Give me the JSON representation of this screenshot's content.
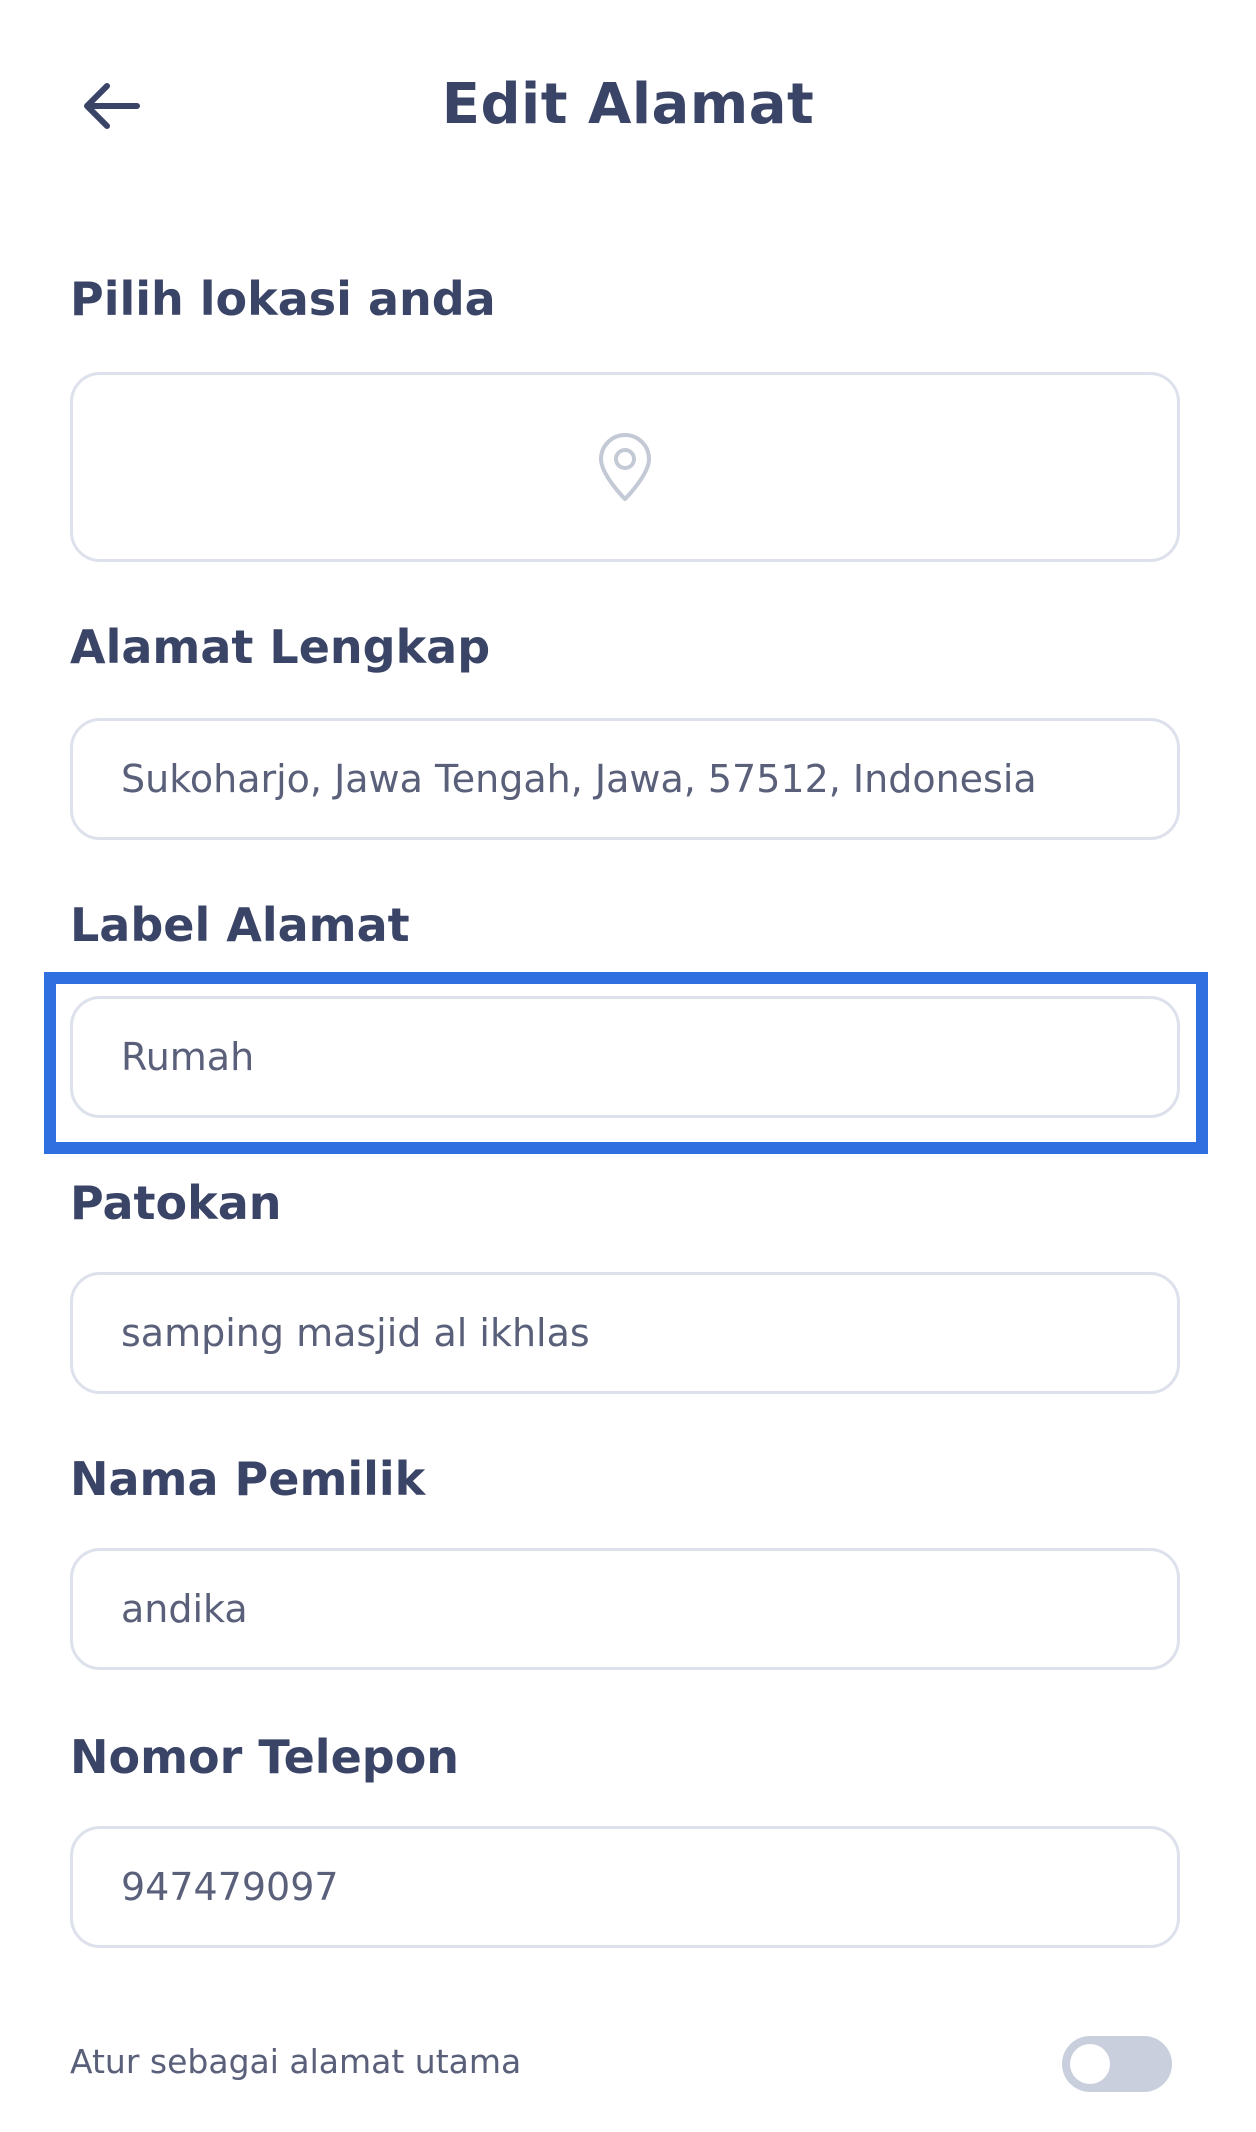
{
  "header": {
    "title": "Edit Alamat",
    "back_icon": "arrow-left-icon"
  },
  "location": {
    "label": "Pilih lokasi anda",
    "icon": "map-pin-icon"
  },
  "address": {
    "label": "Alamat Lengkap",
    "value": "Sukoharjo, Jawa Tengah, Jawa, 57512, Indonesia"
  },
  "address_label": {
    "label": "Label Alamat",
    "value": "Rumah"
  },
  "landmark": {
    "label": "Patokan",
    "value": "samping masjid al ikhlas"
  },
  "owner": {
    "label": "Nama Pemilik",
    "value": "andika"
  },
  "phone": {
    "label": "Nomor Telepon",
    "value": "947479097"
  },
  "primary": {
    "label": "Atur sebagai alamat utama",
    "enabled": false
  },
  "colors": {
    "text": "#3a4466",
    "border": "#dde1ec",
    "highlight": "#2f6fe0",
    "toggle_off": "#c9cfdd"
  }
}
